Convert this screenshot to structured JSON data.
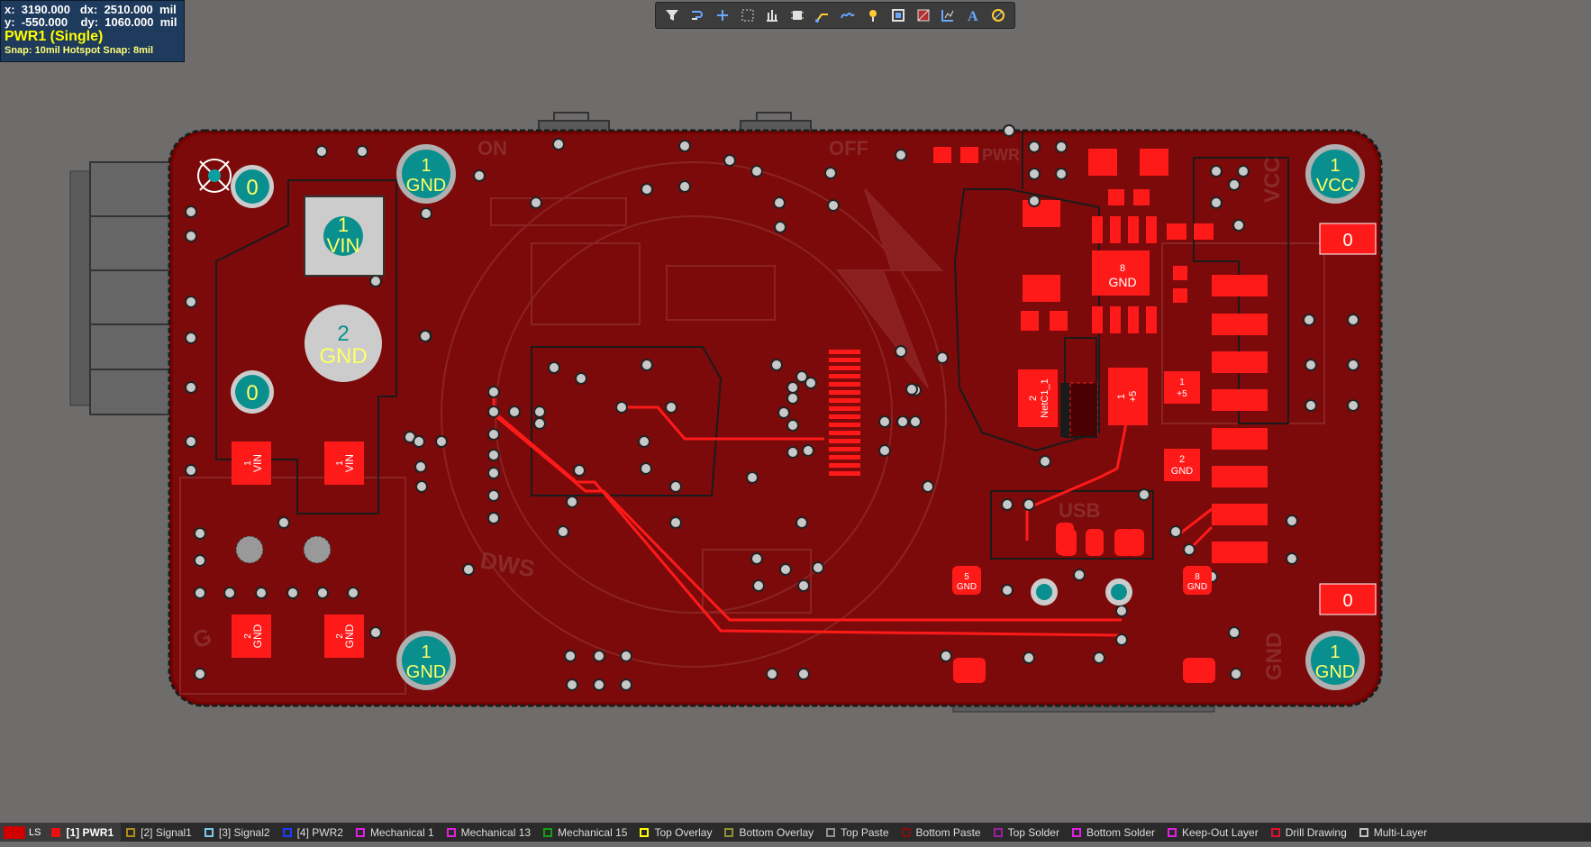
{
  "hud": {
    "x_line": "x:  3190.000   dx:  2510.000  mil",
    "y_line": "y:  -550.000    dy:  1060.000  mil",
    "layer": "PWR1 (Single)",
    "snap": "Snap: 10mil Hotspot Snap: 8mil"
  },
  "toolbar": {
    "icons": [
      "filter-icon",
      "route-icon",
      "add-icon",
      "select-rect-icon",
      "align-icon",
      "component-icon",
      "interactive-route-icon",
      "diff-pair-icon",
      "pin-icon",
      "fill-icon",
      "polygon-icon",
      "dimension-icon",
      "text-icon",
      "arc-icon"
    ]
  },
  "board": {
    "labels": {
      "on": "ON",
      "off": "OFF",
      "pwr": "PWR",
      "vcc_silk": "VCC",
      "gnd_silk": "GND",
      "usb": "USB",
      "dws": "DWS",
      "g": "G"
    },
    "mount_holes": [
      {
        "num": "1",
        "net": "GND"
      },
      {
        "num": "1",
        "net": "GND"
      },
      {
        "num": "1",
        "net": "GND"
      },
      {
        "num": "1",
        "net": "VCC"
      },
      {
        "num": "1",
        "net": "GND"
      }
    ],
    "pads": {
      "vin_sq_num": "1",
      "vin_sq_net": "VIN",
      "gnd_round_num": "2",
      "gnd_round_net": "GND",
      "zero": "0",
      "p1_vin": "1",
      "vin": "VIN",
      "p2_gnd": "2",
      "gnd": "GND",
      "netc1": "NetC1_1",
      "plus5": "+5",
      "one": "1",
      "two": "2",
      "five": "5",
      "eight": "8"
    }
  },
  "layer_tabs": {
    "ls": "LS",
    "items": [
      {
        "label": "[1] PWR1",
        "color": "#e81010",
        "active": true
      },
      {
        "label": "[2] Signal1",
        "color": "#b08a1a"
      },
      {
        "label": "[3] Signal2",
        "color": "#7ec8f0"
      },
      {
        "label": "[4] PWR2",
        "color": "#1a3cff"
      },
      {
        "label": "Mechanical 1",
        "color": "#e020e0"
      },
      {
        "label": "Mechanical 13",
        "color": "#e020e0"
      },
      {
        "label": "Mechanical 15",
        "color": "#10a010"
      },
      {
        "label": "Top Overlay",
        "color": "#ffff00"
      },
      {
        "label": "Bottom Overlay",
        "color": "#909030"
      },
      {
        "label": "Top Paste",
        "color": "#909090"
      },
      {
        "label": "Bottom Paste",
        "color": "#801010"
      },
      {
        "label": "Top Solder",
        "color": "#a020a0"
      },
      {
        "label": "Bottom Solder",
        "color": "#e020e0"
      },
      {
        "label": "Keep-Out Layer",
        "color": "#e020e0"
      },
      {
        "label": "Drill Drawing",
        "color": "#e01030"
      },
      {
        "label": "Multi-Layer",
        "color": "#c0c0c0"
      }
    ]
  }
}
